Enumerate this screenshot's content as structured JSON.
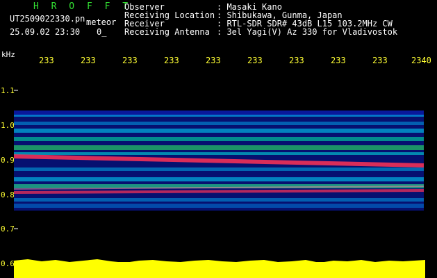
{
  "header": {
    "program": "H R O F F T",
    "filename": "UT2509022330.pn",
    "tag": "meteor",
    "datetime": "25.09.02 23:30",
    "extra": "0_"
  },
  "info": [
    {
      "label": "Observer",
      "value": ": Masaki Kano"
    },
    {
      "label": "Receiving Location",
      "value": ": Shibukawa, Gunma, Japan"
    },
    {
      "label": "Receiver",
      "value": ": RTL-SDR SDR# 43dB L15 103.2MHz CW"
    },
    {
      "label": "Receiving Antenna",
      "value": ": 3el Yagi(V) Az 330 for Vladivostok"
    }
  ],
  "axis": {
    "y_unit": "kHz",
    "y_ticks": [
      "1.1",
      "1.0",
      "0.9",
      "0.8",
      "0.7",
      "0.6"
    ],
    "x_ticks": [
      "233",
      "233",
      "233",
      "233",
      "233",
      "233",
      "233",
      "233",
      "233",
      "2340"
    ]
  },
  "colors": {
    "background": "#000000",
    "header_text": "#ffffff",
    "program_text": "#33e333",
    "axis_text": "#ffff33",
    "signal_low": "#0a1aa0",
    "signal_mid": "#00d0ff",
    "signal_high": "#ff3355",
    "level_fill": "#ffff00"
  }
}
